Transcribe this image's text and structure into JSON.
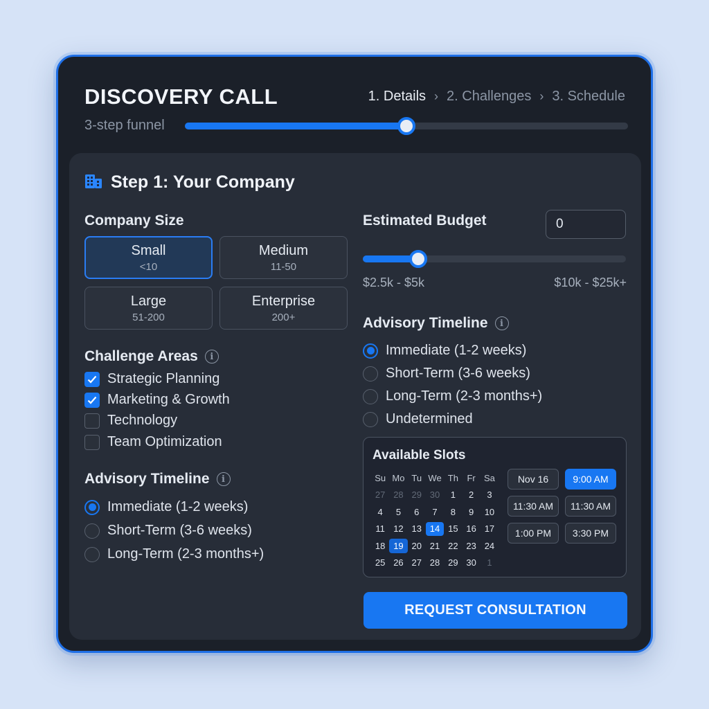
{
  "header": {
    "title": "DISCOVERY CALL",
    "subtitle": "3-step funnel",
    "steps": [
      "1. Details",
      "2. Challenges",
      "3. Schedule"
    ],
    "active_step": 0,
    "progress": 0.5
  },
  "panel": {
    "title": "Step 1: Your Company",
    "icon": "building-icon"
  },
  "company_size": {
    "label": "Company Size",
    "options": [
      {
        "name": "Small",
        "range": "<10",
        "selected": true
      },
      {
        "name": "Medium",
        "range": "11-50",
        "selected": false
      },
      {
        "name": "Large",
        "range": "51-200",
        "selected": false
      },
      {
        "name": "Enterprise",
        "range": "200+",
        "selected": false
      }
    ]
  },
  "challenges": {
    "label": "Challenge Areas",
    "items": [
      {
        "label": "Strategic Planning",
        "checked": true
      },
      {
        "label": "Marketing & Growth",
        "checked": true
      },
      {
        "label": "Technology",
        "checked": false
      },
      {
        "label": "Team Optimization",
        "checked": false
      }
    ]
  },
  "timeline_left": {
    "label": "Advisory Timeline",
    "options": [
      {
        "label": "Immediate (1-2 weeks)",
        "selected": true
      },
      {
        "label": "Short-Term (3-6 weeks)",
        "selected": false
      },
      {
        "label": "Long-Term (2-3 months+)",
        "selected": false
      }
    ]
  },
  "budget": {
    "label": "Estimated Budget",
    "value": "0",
    "min_label": "$2.5k - $5k",
    "max_label": "$10k - $25k+",
    "slider_fraction": 0.21
  },
  "timeline_right": {
    "label": "Advisory Timeline",
    "options": [
      {
        "label": "Immediate (1-2 weeks)",
        "selected": true
      },
      {
        "label": "Short-Term (3-6 weeks)",
        "selected": false
      },
      {
        "label": "Long-Term (2-3 months+)",
        "selected": false
      },
      {
        "label": "Undetermined",
        "selected": false
      }
    ]
  },
  "slots": {
    "title": "Available Slots",
    "weekdays": [
      "Su",
      "Mo",
      "Tu",
      "We",
      "Th",
      "Fr",
      "Sa"
    ],
    "days": [
      {
        "d": "27",
        "muted": true
      },
      {
        "d": "28",
        "muted": true
      },
      {
        "d": "29",
        "muted": true
      },
      {
        "d": "30",
        "muted": true
      },
      {
        "d": "1"
      },
      {
        "d": "2"
      },
      {
        "d": "3"
      },
      {
        "d": "4"
      },
      {
        "d": "5"
      },
      {
        "d": "6"
      },
      {
        "d": "7"
      },
      {
        "d": "8"
      },
      {
        "d": "9"
      },
      {
        "d": "10"
      },
      {
        "d": "11"
      },
      {
        "d": "12"
      },
      {
        "d": "13"
      },
      {
        "d": "14",
        "selected": true
      },
      {
        "d": "15"
      },
      {
        "d": "16"
      },
      {
        "d": "17"
      },
      {
        "d": "18"
      },
      {
        "d": "19",
        "highlight": true
      },
      {
        "d": "20"
      },
      {
        "d": "21"
      },
      {
        "d": "22"
      },
      {
        "d": "23"
      },
      {
        "d": "24"
      },
      {
        "d": "25"
      },
      {
        "d": "26"
      },
      {
        "d": "27"
      },
      {
        "d": "28"
      },
      {
        "d": "29"
      },
      {
        "d": "30"
      },
      {
        "d": "1",
        "muted": true
      }
    ],
    "times": [
      {
        "label": "Nov 16",
        "selected": false
      },
      {
        "label": "9:00 AM",
        "selected": true
      },
      {
        "label": "11:30 AM",
        "selected": false
      },
      {
        "label": "11:30 AM",
        "selected": false
      },
      {
        "label": "1:00 PM",
        "selected": false
      },
      {
        "label": "3:30 PM",
        "selected": false
      }
    ]
  },
  "cta": {
    "label": "REQUEST CONSULTATION"
  },
  "colors": {
    "accent": "#1877f2",
    "card_bg": "#1b2029",
    "panel_bg": "#272d38",
    "page_bg": "#d6e3f7"
  }
}
